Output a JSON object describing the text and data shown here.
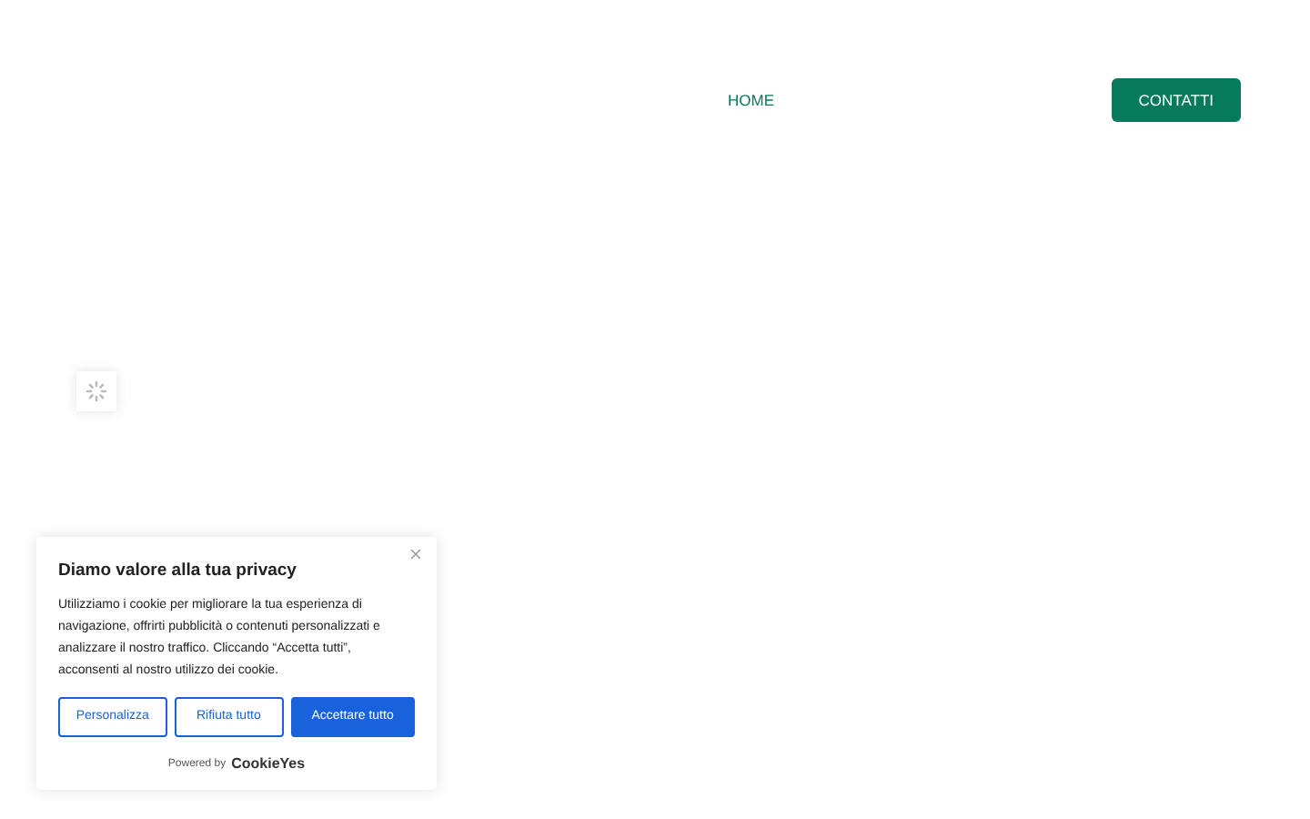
{
  "nav": {
    "items": [
      {
        "label": "HOME"
      }
    ],
    "cta": "CONTATTI"
  },
  "cookie_banner": {
    "title": "Diamo valore alla tua privacy",
    "text": "Utilizziamo i cookie per migliorare la tua esperienza di navigazione, offrirti pubblicità o contenuti personalizzati e analizzare il nostro traffico. Cliccando “Accetta tutti”, acconsenti al nostro utilizzo dei cookie.",
    "buttons": [
      {
        "label": "Personalizza",
        "kind": "outline"
      },
      {
        "label": "Rifiuta tutto",
        "kind": "outline"
      },
      {
        "label": "Accettare tutto",
        "kind": "primary"
      }
    ],
    "powered_by": "Powered by",
    "brand": "CookieYes"
  }
}
